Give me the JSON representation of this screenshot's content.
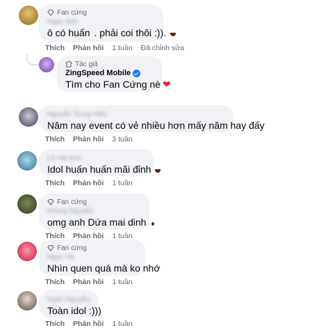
{
  "comments": [
    {
      "badge": "Fan cứng",
      "author": "Ngọc Ánh",
      "text": "ô có huấn",
      "text_after": ". phải coi thôi :)).",
      "actions": {
        "like": "Thích",
        "reply": "Phản hồi",
        "time": "1 tuần",
        "edited": "Đã chỉnh sửa"
      }
    },
    {
      "badge": "Tác giả",
      "author": "ZingSpeed Mobile",
      "text": "Tìm cho Fan Cứng nè",
      "is_reply": true
    },
    {
      "author": "Nguyễn Trung Hiếu",
      "text": "Năm nay event có vẻ nhiều hơn mấy năm hay đấy",
      "actions": {
        "like": "Thích",
        "reply": "Phản hồi",
        "time": "3 tuần"
      }
    },
    {
      "author": "Lê Hải Anh",
      "text": "Idol huấn huấn mãi đỉnh",
      "actions": {
        "like": "Thích",
        "reply": "Phản hồi",
        "time": "1 tuần"
      }
    },
    {
      "badge": "Fan cứng",
      "author": "Khang Nguyễn",
      "text": "omg anh Dứa mai dinh",
      "actions": {
        "like": "Thích",
        "reply": "Phản hồi",
        "time": "1 tuần"
      }
    },
    {
      "badge": "Fan cứng",
      "author": "Ngọc Hà",
      "text": "Nhìn quen quá mà ko nhớ",
      "actions": {
        "like": "Thích",
        "reply": "Phản hồi",
        "time": "1 tuần"
      }
    },
    {
      "author": "Ngân Nguyễn",
      "text": "Toàn idol :)))",
      "actions": {
        "like": "Thích",
        "reply": "Phản hồi",
        "time": "1 tuần"
      }
    }
  ],
  "colors": {
    "bubble": "#f0f2f5",
    "meta": "#65676b",
    "verified": "#1877f2",
    "heart": "#e41e3f"
  },
  "icons": [
    "fan-badge-icon",
    "author-badge-icon",
    "verified-icon",
    "laugh-emoji-icon",
    "wow-emoji-icon",
    "sleepy-emoji-icon",
    "heart-icon"
  ]
}
